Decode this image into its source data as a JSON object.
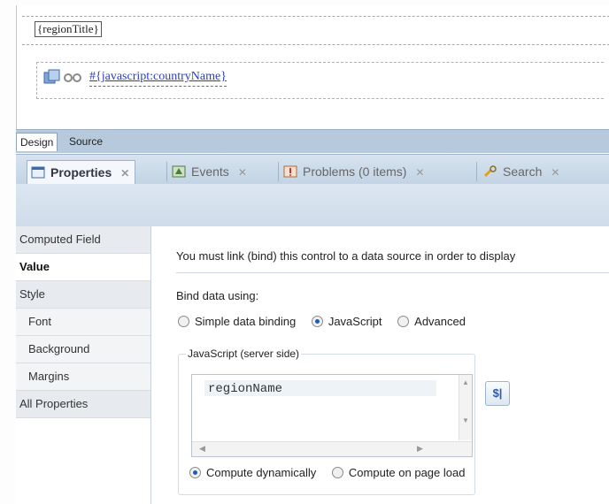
{
  "canvas": {
    "region_title": "{regionTitle}",
    "computed_field_link": "#{javascript:countryName}"
  },
  "design_tabs": [
    "Design",
    "Source"
  ],
  "panel_tabs": [
    {
      "label": "Properties",
      "active": true
    },
    {
      "label": "Events"
    },
    {
      "label": "Problems (0 items)"
    },
    {
      "label": "Search"
    }
  ],
  "nav": {
    "items": [
      {
        "label": "Computed Field"
      },
      {
        "label": "Value"
      },
      {
        "label": "Style"
      },
      {
        "label": "Font"
      },
      {
        "label": "Background"
      },
      {
        "label": "Margins"
      },
      {
        "label": "All Properties"
      }
    ]
  },
  "content": {
    "notice": "You must link (bind) this control to a data source in order to display",
    "bind_label": "Bind data using:",
    "bind_options": [
      "Simple data binding",
      "JavaScript",
      "Advanced"
    ],
    "bind_selected": "JavaScript",
    "group_title": "JavaScript (server side)",
    "script_value": "regionName",
    "compute_options": [
      "Compute dynamically",
      "Compute on page load"
    ],
    "compute_selected": "Compute dynamically"
  },
  "colors": {
    "tab_band": "#c2d3e4",
    "link_blue": "#2a3fc0",
    "radio_selected": "#1e5bb8"
  }
}
